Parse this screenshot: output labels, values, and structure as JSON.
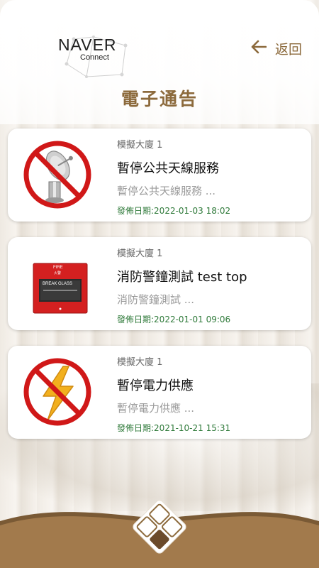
{
  "header": {
    "logo_text": "NAVER",
    "logo_sub": "Connect",
    "back_label": "返回",
    "title": "電子通告"
  },
  "notices": [
    {
      "building": "模擬大廈 1",
      "title": "暫停公共天線服務",
      "summary": "暫停公共天線服務 ...",
      "date": "發佈日期:2022-01-03 18:02",
      "icon": "no-antenna-icon"
    },
    {
      "building": "模擬大廈 1",
      "title": "消防警鐘測試 test top",
      "summary": "消防警鐘測試 ...",
      "date": "發佈日期:2022-01-01 09:06",
      "icon": "fire-alarm-icon",
      "image_text": {
        "fire": "FIRE",
        "fire_zh": "火警",
        "break_glass": "BREAK GLASS"
      }
    },
    {
      "building": "模擬大廈 1",
      "title": "暫停電力供應",
      "summary": "暫停電力供應 ...",
      "date": "發佈日期:2021-10-21 15:31",
      "icon": "no-power-icon"
    }
  ],
  "colors": {
    "accent": "#8c6a3c",
    "date_green": "#2f7a3a",
    "footer_brown": "#a27a4c"
  },
  "footer": {
    "home_icon": "home-menu-icon"
  }
}
